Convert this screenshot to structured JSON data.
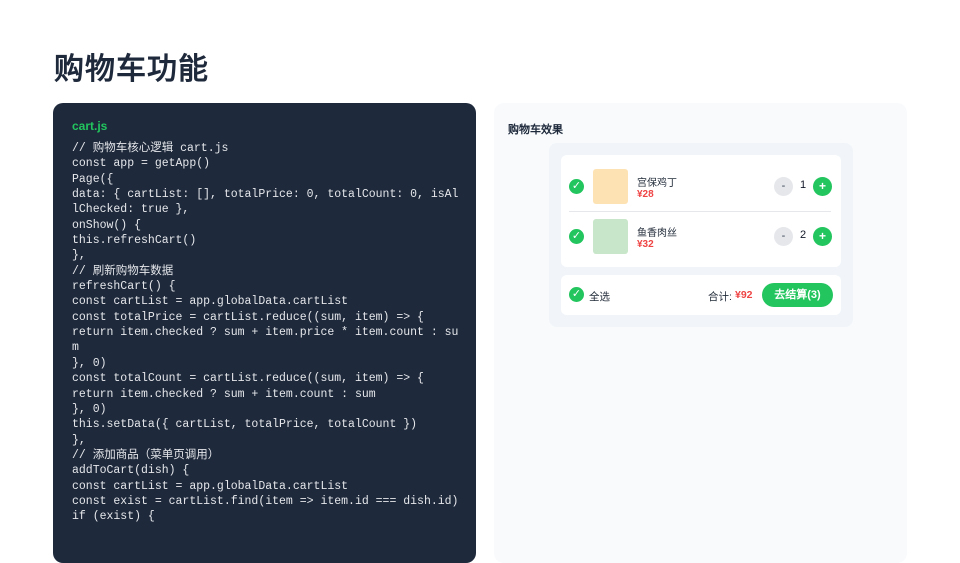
{
  "page": {
    "title": "购物车功能"
  },
  "code": {
    "filename": "cart.js",
    "lines": [
      "// 购物车核心逻辑 cart.js",
      "const app = getApp()",
      "Page({",
      "data: { cartList: [], totalPrice: 0, totalCount: 0, isAllChecked: true },",
      "onShow() {",
      "this.refreshCart()",
      "},",
      "// 刷新购物车数据",
      "refreshCart() {",
      "const cartList = app.globalData.cartList",
      "const totalPrice = cartList.reduce((sum, item) => {",
      "return item.checked ? sum + item.price * item.count : sum",
      "}, 0)",
      "const totalCount = cartList.reduce((sum, item) => {",
      "return item.checked ? sum + item.count : sum",
      "}, 0)",
      "this.setData({ cartList, totalPrice, totalCount })",
      "},",
      "// 添加商品（菜单页调用）",
      "addToCart(dish) {",
      "const cartList = app.globalData.cartList",
      "const exist = cartList.find(item => item.id === dish.id)",
      "if (exist) {"
    ]
  },
  "preview": {
    "title": "购物车效果",
    "check_mark": "✓",
    "items": [
      {
        "name": "宫保鸡丁",
        "price": "¥28",
        "minus": "-",
        "quantity": "1",
        "plus": "+",
        "thumb_color": "#fde2b4"
      },
      {
        "name": "鱼香肉丝",
        "price": "¥32",
        "minus": "-",
        "quantity": "2",
        "plus": "+",
        "thumb_color": "#c8e6c9"
      }
    ],
    "footer": {
      "select_all": "全选",
      "total_label": "合计:",
      "total_price": "¥92",
      "checkout": "去结算(3)"
    }
  },
  "colors": {
    "accent_green": "#22c55e",
    "price_red": "#ef4444",
    "code_background": "#1e293b"
  }
}
